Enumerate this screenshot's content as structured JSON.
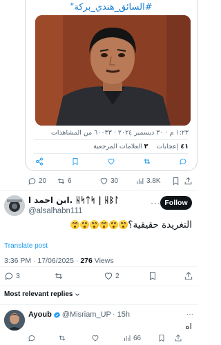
{
  "quoted_screenshot": {
    "caption": "#السائق_هندي_بركة\"",
    "meta_line": "١:٢٣ م · ٣٠ ديسمبر ٢٠٢٤ · ٦٠٠٣٣ من المشاهدات",
    "likes_value": "٤١",
    "likes_label": "إعجابات",
    "bookmarks_value": "٣",
    "bookmarks_label": "العلامات المرجعية"
  },
  "quoted_actions": {
    "replies": "20",
    "reposts": "6",
    "likes": "30",
    "views": "3.8K"
  },
  "tweet": {
    "display_name": "ابن احمد ا. ᚺᛋᛏᛋ | ᚺᛒᛚ",
    "handle": "@alsalhabn111",
    "follow_label": "Follow",
    "more_label": "···",
    "text": "التغريدة حقيقية؟",
    "translate_label": "Translate post",
    "time": "3:36 PM · 17/06/2025 · ",
    "views_count": "276",
    "views_label": " Views",
    "replies": "3",
    "reposts": "",
    "likes": "2"
  },
  "replies_section": {
    "sort_label": "Most relevant replies"
  },
  "reply": {
    "name": "Ayoub",
    "handle": "@Misriam_UP",
    "time": "· 15h",
    "more_label": "···",
    "text": "اه",
    "replies": "",
    "reposts": "",
    "likes": "",
    "views": "66"
  },
  "colors": {
    "accent": "#1d9bf0",
    "text": "#0f1419",
    "muted": "#536471",
    "follow_button": "#0f1419"
  },
  "icons": [
    "reply-icon",
    "repost-icon",
    "like-icon",
    "views-icon",
    "bookmark-icon",
    "share-icon",
    "verified-icon",
    "chevron-down-icon"
  ]
}
